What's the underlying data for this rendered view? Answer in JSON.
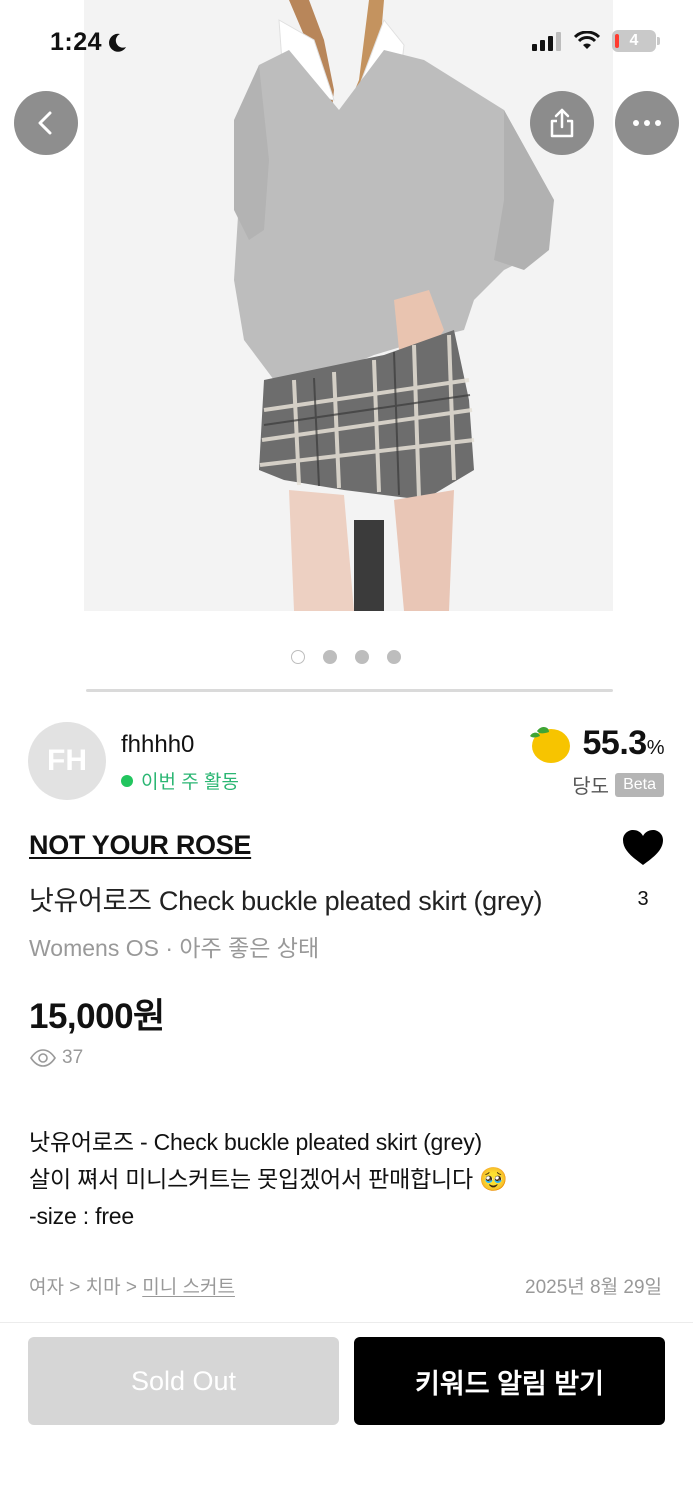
{
  "status_bar": {
    "time": "1:24",
    "battery": "4"
  },
  "nav": {
    "back_icon": "chevron-left-icon",
    "share_icon": "share-icon",
    "more_icon": "more-icon"
  },
  "gallery": {
    "total_images": 4,
    "active_index": 0
  },
  "seller": {
    "avatar_initials": "FH",
    "name": "fhhhh0",
    "activity": "이번 주 활동",
    "activity_color": "#22c55e",
    "sweetness_value": "55.3",
    "sweetness_unit": "%",
    "sweetness_label": "당도",
    "beta_badge": "Beta"
  },
  "product": {
    "brand": "NOT YOUR ROSE",
    "title": "낫유어로즈 Check buckle pleated skirt (grey)",
    "meta": "Womens OS · 아주 좋은 상태",
    "likes": "3",
    "price": "15,000원",
    "views": "37",
    "description": [
      "낫유어로즈 - Check buckle pleated skirt (grey)",
      "살이 쪄서 미니스커트는 못입겠어서 판매합니다 🥹",
      "-size : free"
    ],
    "breadcrumb": {
      "level1": "여자",
      "level2": "치마",
      "level3": "미니 스커트",
      "separator": " > "
    },
    "date": "2025년 8월 29일"
  },
  "actions": {
    "sold_out_label": "Sold Out",
    "keyword_alert_label": "키워드 알림 받기"
  }
}
